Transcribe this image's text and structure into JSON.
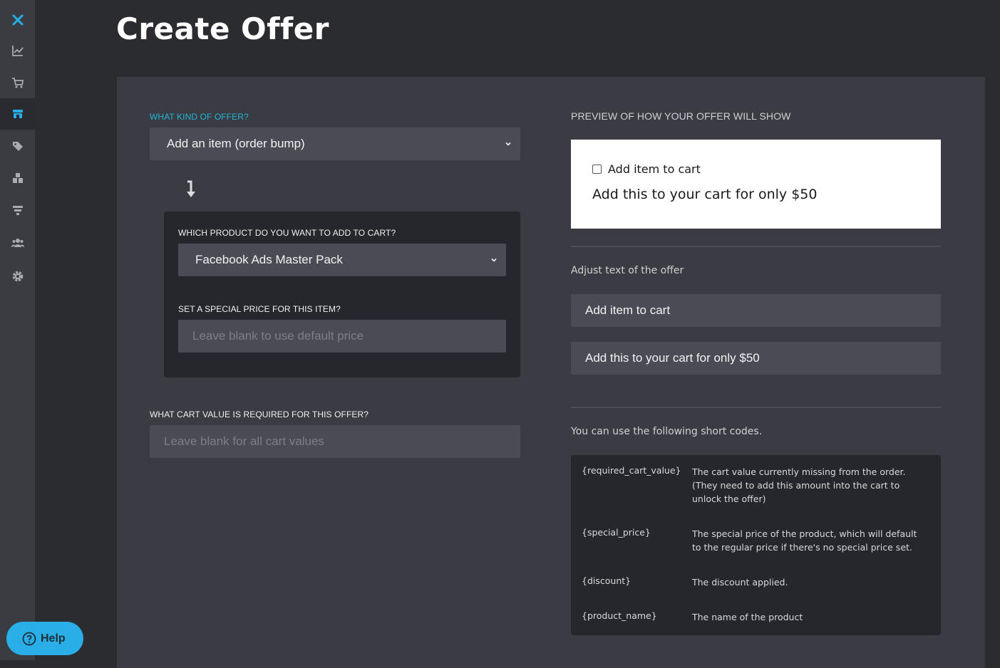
{
  "page": {
    "title": "Create Offer"
  },
  "sidebar": {
    "items": [
      {
        "icon": "close-icon"
      },
      {
        "icon": "chart-icon"
      },
      {
        "icon": "cart-icon"
      },
      {
        "icon": "store-icon",
        "active": true
      },
      {
        "icon": "tag-icon"
      },
      {
        "icon": "boxes-icon"
      },
      {
        "icon": "funnel-icon"
      },
      {
        "icon": "users-icon"
      },
      {
        "icon": "gear-icon"
      }
    ]
  },
  "form": {
    "offer_kind_label": "WHAT KIND OF OFFER?",
    "offer_kind_value": "Add an item (order bump)",
    "product_label": "WHICH PRODUCT DO YOU WANT TO ADD TO CART?",
    "product_value": "Facebook Ads Master Pack",
    "price_label": "SET A SPECIAL PRICE FOR THIS ITEM?",
    "price_placeholder": "Leave blank to use default price",
    "cart_value_label": "WHAT CART VALUE IS REQUIRED FOR THIS OFFER?",
    "cart_value_placeholder": "Leave blank for all cart values"
  },
  "preview": {
    "label": "PREVIEW OF HOW YOUR OFFER WILL SHOW",
    "checkbox_text": "Add item to cart",
    "offer_text": "Add this to your cart for only $50"
  },
  "adjust": {
    "label": "Adjust text of the offer",
    "checkbox_text_value": "Add item to cart",
    "offer_text_value": "Add this to your cart for only $50"
  },
  "short_codes": {
    "label": "You can use the following short codes.",
    "rows": [
      {
        "code": "{required_cart_value}",
        "desc": "The cart value currently missing from the order. (They need to add this amount into the cart to unlock the offer)"
      },
      {
        "code": "{special_price}",
        "desc": "The special price of the product, which will default to the regular price if there's no special price set."
      },
      {
        "code": "{discount}",
        "desc": "The discount applied."
      },
      {
        "code": "{product_name}",
        "desc": "The name of the product"
      }
    ]
  },
  "help": {
    "label": "Help"
  },
  "colors": {
    "accent": "#1fb6d3",
    "help_button": "#2aaee7",
    "sidebar": "#3b3c42",
    "panel": "#3b3c43"
  }
}
